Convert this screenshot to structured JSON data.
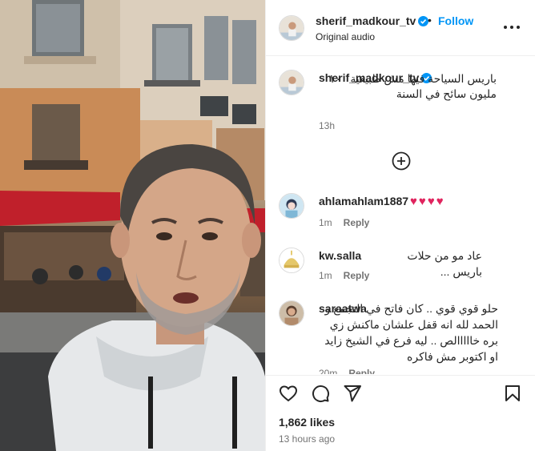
{
  "post": {
    "username": "sherif_madkour_tv",
    "follow_label": "Follow",
    "separator": "•",
    "audio_label": "Original audio"
  },
  "caption": {
    "username": "sherif_madkour_tv",
    "text": "باريس السياحة فيها مش طبيعية ١٠٠ مليون سائح في السنة",
    "time": "13h"
  },
  "comments": [
    {
      "username": "ahlamahlam1887",
      "text": "♥♥♥♥",
      "time": "1m",
      "reply_label": "Reply"
    },
    {
      "username": "kw.salla",
      "text": "عاد مو من حلات باريس ...",
      "time": "1m",
      "reply_label": "Reply"
    },
    {
      "username": "saraatwa",
      "text": "حلو قوي قوي .. كان فاتح في التجمع و الحمد لله انه قفل علشان ماكنش زي بره خااااالص .. ليه فرع في الشيخ زايد او اكتوبر مش فاكره",
      "time": "20m",
      "reply_label": "Reply"
    }
  ],
  "footer": {
    "likes": "1,862 likes",
    "time_ago": "13 hours ago"
  },
  "icons": {
    "verified": "verified-badge-icon",
    "more": "more-options-icon",
    "add_comment": "plus-circle-icon",
    "like": "heart-icon",
    "comment": "comment-bubble-icon",
    "share": "send-icon",
    "save": "bookmark-icon"
  },
  "colors": {
    "link": "#0095f6",
    "verified": "#0095f6",
    "heart": "#e0245e",
    "muted": "#737373",
    "text": "#262626"
  }
}
